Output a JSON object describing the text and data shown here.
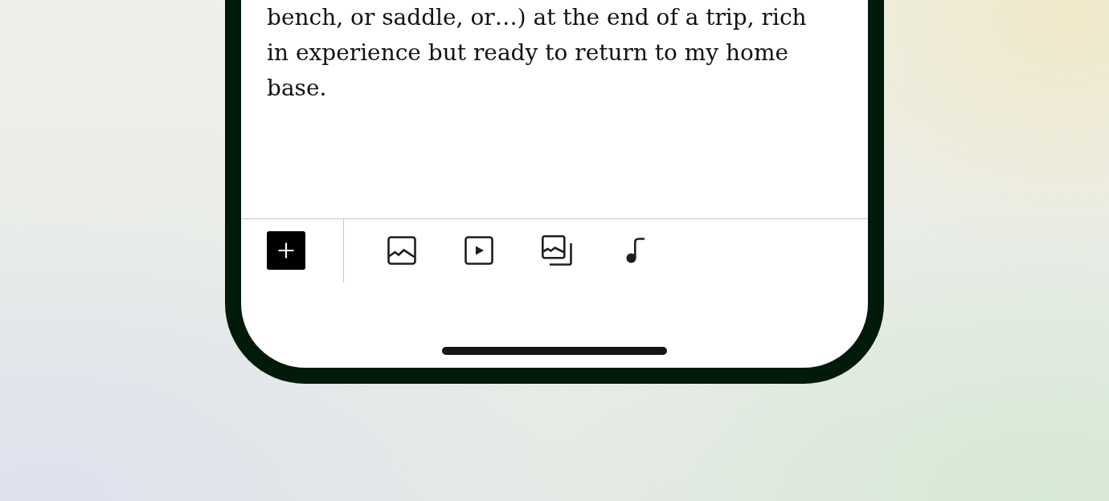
{
  "editor": {
    "paragraph": "bench, or saddle, or…) at the end of a trip, rich in experience but ready to return to my home base."
  }
}
